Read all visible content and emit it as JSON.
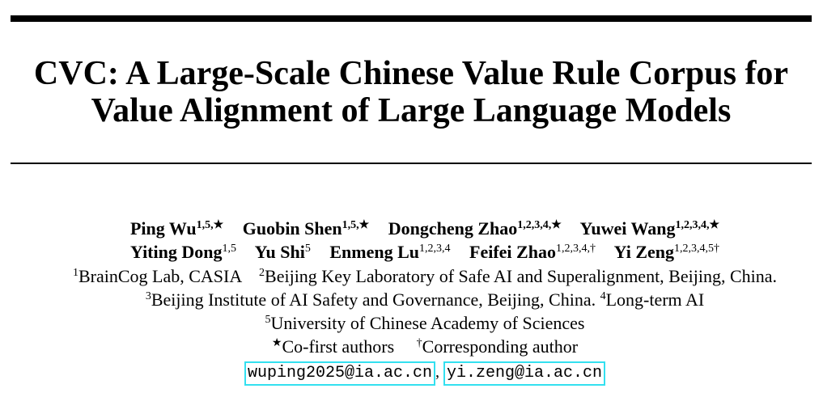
{
  "title": {
    "line1": "CVC: A Large-Scale Chinese Value Rule Corpus for",
    "line2": "Value Alignment of Large Language Models"
  },
  "authors": [
    {
      "name": "Ping Wu",
      "sup": "1,5,★"
    },
    {
      "name": "Guobin Shen",
      "sup": "1,5,★"
    },
    {
      "name": "Dongcheng Zhao",
      "sup": "1,2,3,4,★"
    },
    {
      "name": "Yuwei Wang",
      "sup": "1,2,3,4,★"
    },
    {
      "name": "Yiting Dong",
      "sup": "1,5"
    },
    {
      "name": "Yu Shi",
      "sup": "5"
    },
    {
      "name": "Enmeng Lu",
      "sup": "1,2,3,4"
    },
    {
      "name": "Feifei Zhao",
      "sup": "1,2,3,4,†"
    },
    {
      "name": "Yi Zeng",
      "sup": "1,2,3,4,5†"
    }
  ],
  "affiliations": {
    "a1_num": "1",
    "a1": "BrainCog Lab, CASIA",
    "a2_num": "2",
    "a2": "Beijing Key Laboratory of Safe AI and Superalignment, Beijing, China.",
    "a3_num": "3",
    "a3": "Beijing Institute of AI Safety and Governance, Beijing, China.",
    "a4_num": "4",
    "a4": "Long-term AI",
    "a5_num": "5",
    "a5": "University of Chinese Academy of Sciences"
  },
  "notes": {
    "cofirst_mark": "★",
    "cofirst": "Co-first authors",
    "corr_mark": "†",
    "corr": "Corresponding author"
  },
  "emails": {
    "e1": "wuping2025@ia.ac.cn",
    "sep": ",",
    "e2": "yi.zeng@ia.ac.cn"
  }
}
